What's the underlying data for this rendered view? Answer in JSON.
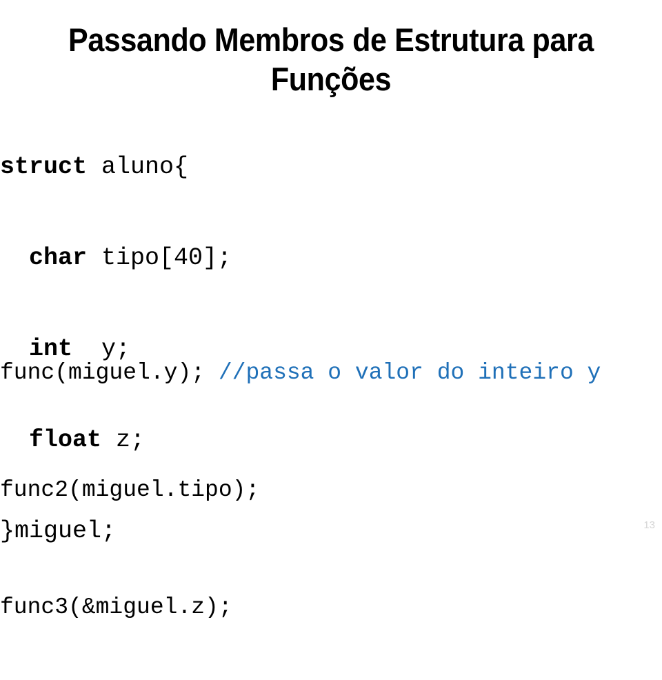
{
  "slide": {
    "title": "Passando Membros de Estrutura para Funções",
    "page_number": "13",
    "colors": {
      "text": "#000000",
      "comment": "#1f70b8",
      "page_number": "#d5d5d5",
      "background": "#ffffff"
    }
  },
  "struct_code": {
    "line1_keyword": "struct",
    "line1_rest": " aluno{",
    "line2_keyword": "char",
    "line2_rest": " tipo[40];",
    "line2_indent": "  ",
    "line3_keyword": "int",
    "line3_rest": "  y;",
    "line3_indent": "  ",
    "line4_keyword": "float",
    "line4_rest": " z;",
    "line4_indent": "  ",
    "line5": "}miguel;"
  },
  "function_calls": {
    "call1_code": "func(miguel.y); ",
    "call1_comment": "//passa o valor do inteiro y",
    "call2_code": "func2(miguel.tipo);",
    "call3_code": "func3(&miguel.z);"
  }
}
